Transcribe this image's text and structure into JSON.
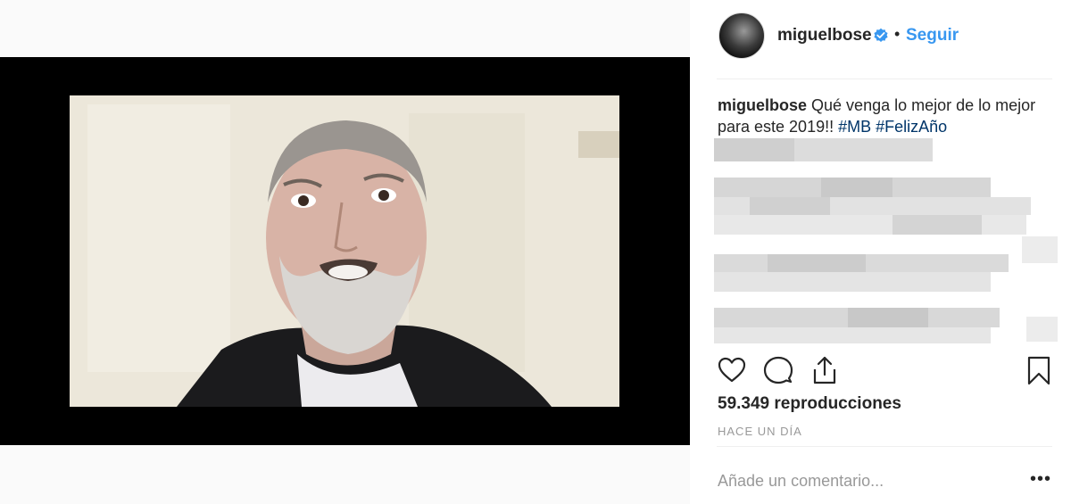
{
  "post": {
    "username": "miguelbose",
    "follow_label": "Seguir",
    "separator": "•",
    "verified": true
  },
  "caption": {
    "username": "miguelbose",
    "text": " Qué venga lo mejor de lo mejor para este 2019!! ",
    "hashtag_1": "#MB",
    "space": " ",
    "hashtag_2": "#FelizAño"
  },
  "stats": {
    "views_label": "59.349 reproducciones",
    "time_label": "HACE UN DÍA"
  },
  "comment": {
    "placeholder": "Añade un comentario...",
    "more_label": "•••"
  },
  "icons": {
    "like": "heart-icon",
    "comment": "comment-icon",
    "share": "share-icon",
    "save": "bookmark-icon",
    "verified": "verified-badge-icon",
    "more": "more-options-icon"
  },
  "colors": {
    "link_blue": "#3897f0",
    "hashtag": "#003569",
    "text": "#262626",
    "muted": "#999999",
    "verified_blue": "#3897f0"
  }
}
